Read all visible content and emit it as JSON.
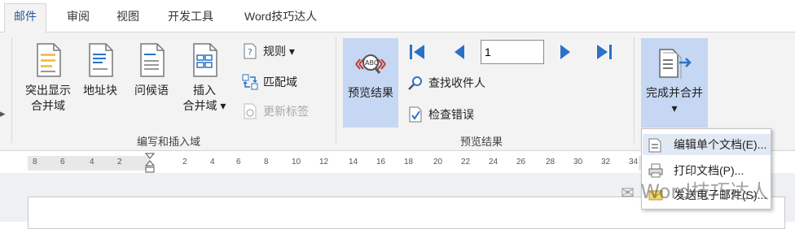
{
  "tabs": [
    {
      "label": "邮件",
      "active": true
    },
    {
      "label": "审阅"
    },
    {
      "label": "视图"
    },
    {
      "label": "开发工具"
    },
    {
      "label": "Word技巧达人"
    }
  ],
  "write_group": {
    "label": "编写和插入域",
    "highlight_fields": "突出显示\n合并域",
    "address_block": "地址块",
    "greeting_line": "问候语",
    "insert_merge_field": "插入\n合并域 ▾",
    "rules": "规则 ▾",
    "match_fields": "匹配域",
    "update_labels": "更新标签"
  },
  "preview_group": {
    "label": "预览结果",
    "preview_results": "预览结果",
    "record_value": "1",
    "find_recipient": "查找收件人",
    "check_errors": "检查错误"
  },
  "finish_group": {
    "finish_merge": "完成并合并\n▾"
  },
  "dropdown": {
    "edit_individual": "编辑单个文档(E)...",
    "print_documents": "打印文档(P)...",
    "send_email": "发送电子邮件(S)..."
  },
  "ruler": {
    "labels": [
      "8",
      "6",
      "4",
      "2",
      "2",
      "4",
      "6",
      "8",
      "10",
      "12",
      "14",
      "16",
      "18",
      "20",
      "22",
      "24",
      "26",
      "28",
      "30",
      "32",
      "34"
    ]
  },
  "watermark": "Word技巧达人",
  "colors": {
    "accent": "#2b579a",
    "selected": "#c5d7f2",
    "ribbon_bg": "#f3f3f3"
  }
}
